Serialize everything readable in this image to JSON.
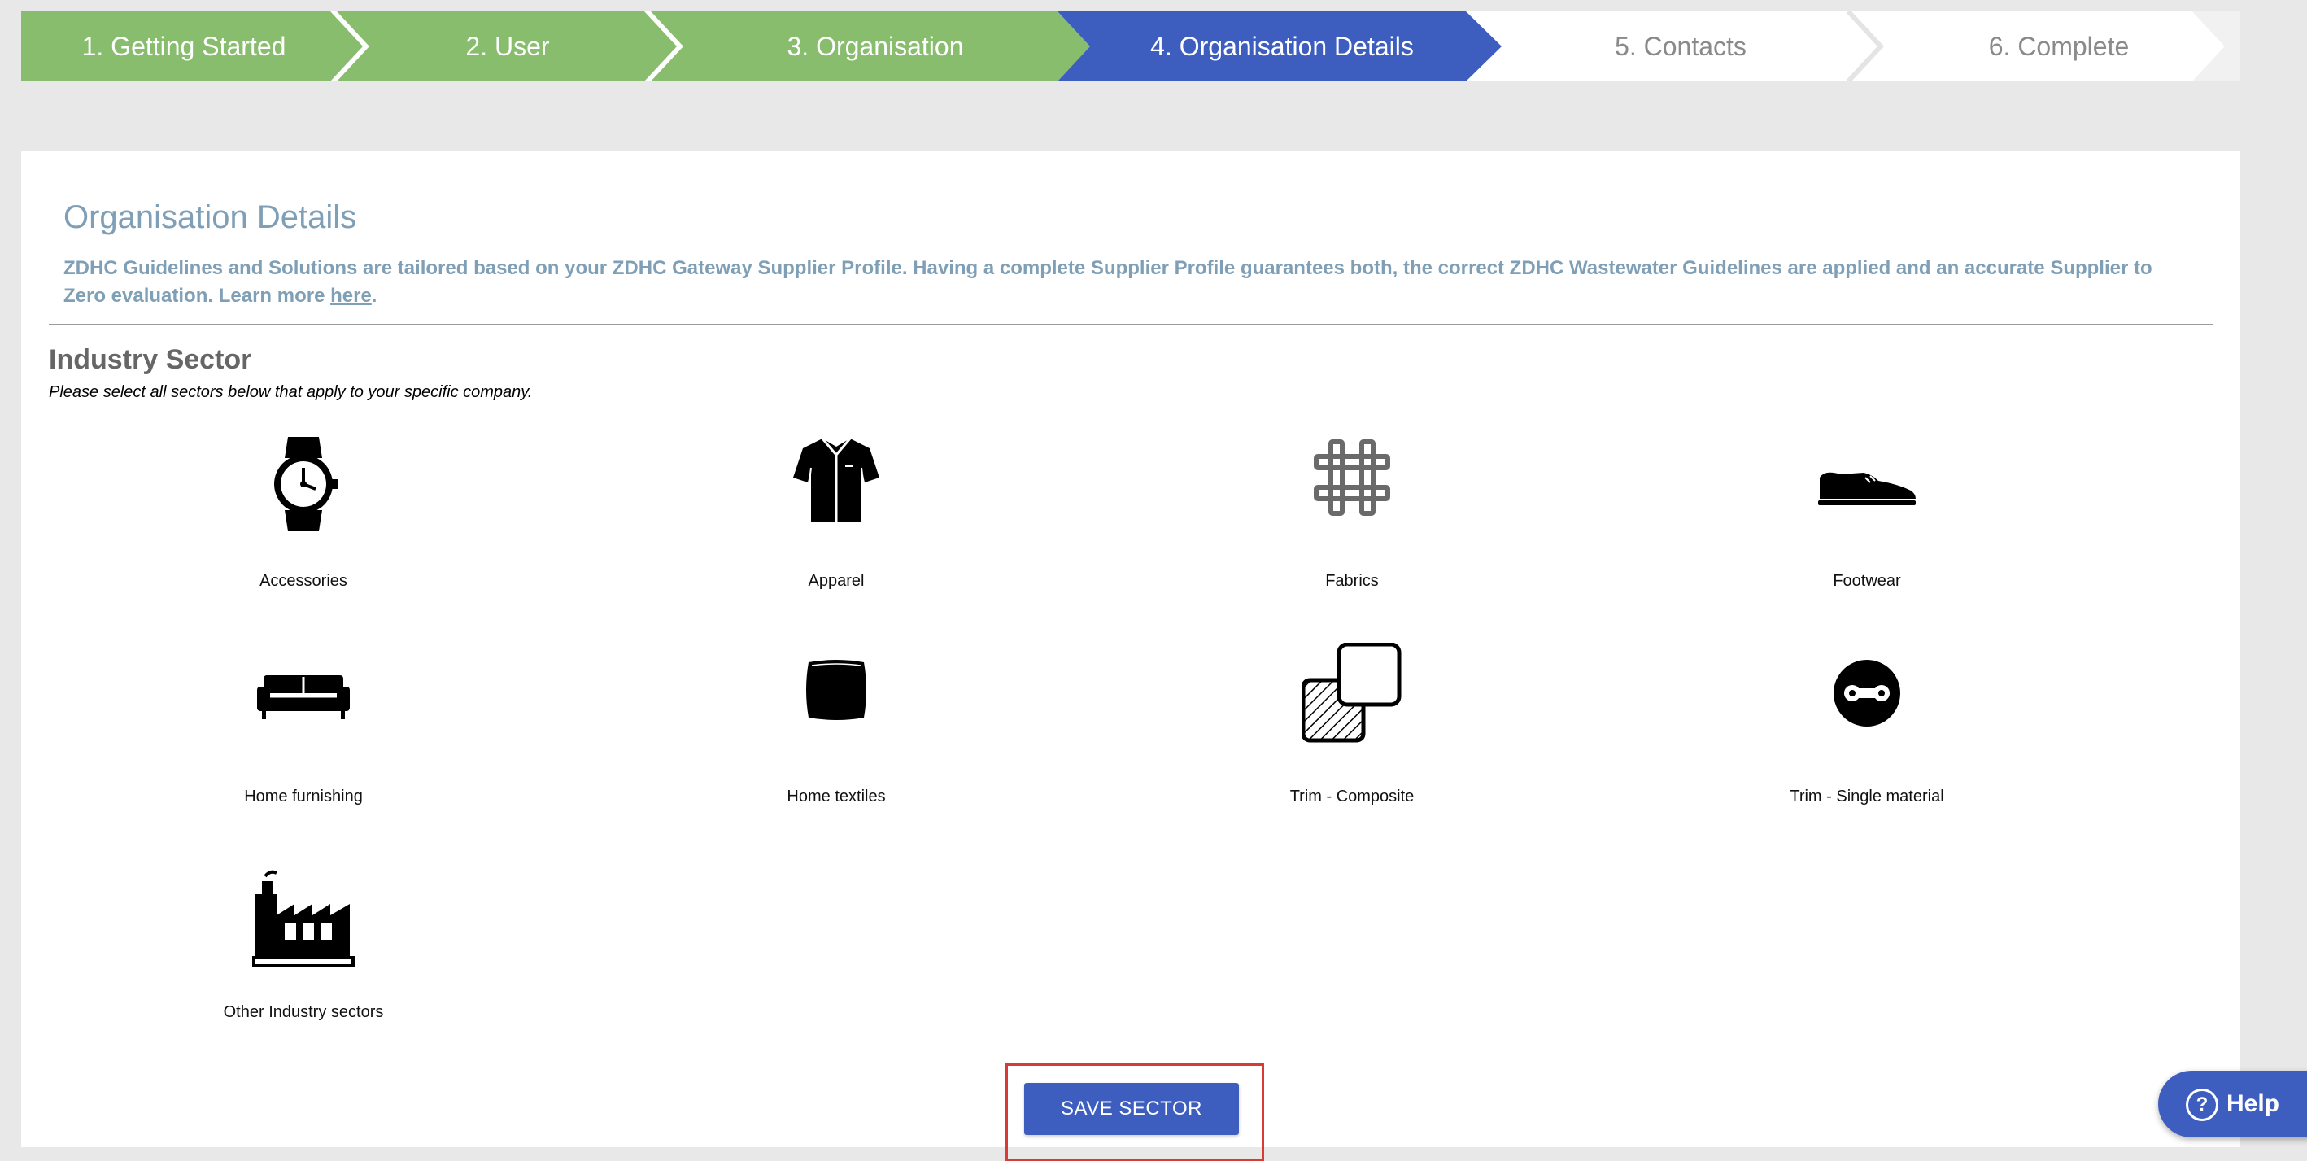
{
  "stepper": {
    "steps": [
      {
        "label": "1. Getting Started",
        "state": "done"
      },
      {
        "label": "2. User",
        "state": "done"
      },
      {
        "label": "3. Organisation",
        "state": "done"
      },
      {
        "label": "4. Organisation Details",
        "state": "active"
      },
      {
        "label": "5. Contacts",
        "state": "todo"
      },
      {
        "label": "6. Complete",
        "state": "todo"
      }
    ],
    "colors": {
      "done": "#88bd6e",
      "active": "#3e5ebf",
      "todo": "#ffffff"
    }
  },
  "page": {
    "title": "Organisation Details",
    "intro": "ZDHC Guidelines and Solutions are tailored based on your ZDHC Gateway Supplier Profile. Having a complete Supplier Profile guarantees both, the correct ZDHC Wastewater Guidelines are applied and an accurate Supplier to Zero evaluation. Learn more",
    "learn_more_link": "here",
    "intro_end": "."
  },
  "industry": {
    "title": "Industry Sector",
    "hint": "Please select all sectors below that apply to your specific company.",
    "sectors": [
      {
        "label": "Accessories",
        "icon": "watch-icon"
      },
      {
        "label": "Apparel",
        "icon": "shirt-icon"
      },
      {
        "label": "Fabrics",
        "icon": "fabric-weave-icon"
      },
      {
        "label": "Footwear",
        "icon": "shoe-icon"
      },
      {
        "label": "Home furnishing",
        "icon": "sofa-icon"
      },
      {
        "label": "Home textiles",
        "icon": "cushion-icon"
      },
      {
        "label": "Trim - Composite",
        "icon": "composite-squares-icon"
      },
      {
        "label": "Trim - Single material",
        "icon": "link-circle-icon"
      },
      {
        "label": "Other Industry sectors",
        "icon": "factory-icon"
      }
    ]
  },
  "actions": {
    "save_label": "SAVE SECTOR",
    "help_label": "Help",
    "help_icon": "question-circle-icon"
  }
}
